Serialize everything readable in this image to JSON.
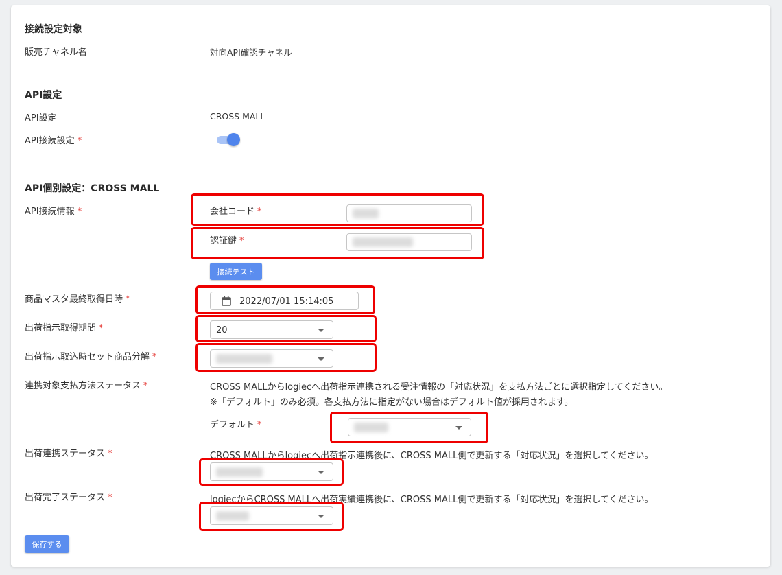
{
  "sections": {
    "connection_target": {
      "title": "接続設定対象",
      "channel_label": "販売チャネル名",
      "channel_value": "対向API確認チャネル"
    },
    "api_settings": {
      "title": "API設定",
      "api_label": "API設定",
      "api_value": "CROSS MALL",
      "connection_label": "API接続設定",
      "connection_enabled": true
    },
    "api_individual": {
      "title": "API個別設定：CROSS MALL",
      "connection_info_label": "API接続情報",
      "company_code_label": "会社コード",
      "auth_key_label": "認証鍵",
      "test_button": "接続テスト",
      "product_master_label": "商品マスタ最終取得日時",
      "product_master_value": "2022/07/01 15:14:05",
      "shipping_period_label": "出荷指示取得期間",
      "shipping_period_value": "20",
      "set_product_label": "出荷指示取込時セット商品分解",
      "payment_status_label": "連携対象支払方法ステータス",
      "payment_status_desc1": "CROSS MALLからlogiecへ出荷指示連携される受注情報の「対応状況」を支払方法ごとに選択指定してください。",
      "payment_status_desc2": "※「デフォルト」のみ必須。各支払方法に指定がない場合はデフォルト値が採用されます。",
      "default_label": "デフォルト",
      "shipping_link_label": "出荷連携ステータス",
      "shipping_link_desc": "CROSS MALLからlogiecへ出荷指示連携後に、CROSS MALL側で更新する「対応状況」を選択してください。",
      "shipping_done_label": "出荷完了ステータス",
      "shipping_done_desc": "logiecからCROSS MALLへ出荷実績連携後に、CROSS MALL側で更新する「対応状況」を選択してください。"
    }
  },
  "required_mark": "*",
  "save_button": "保存する",
  "colors": {
    "accent": "#5b8def",
    "required": "#e53935",
    "highlight": "#ee0000"
  }
}
